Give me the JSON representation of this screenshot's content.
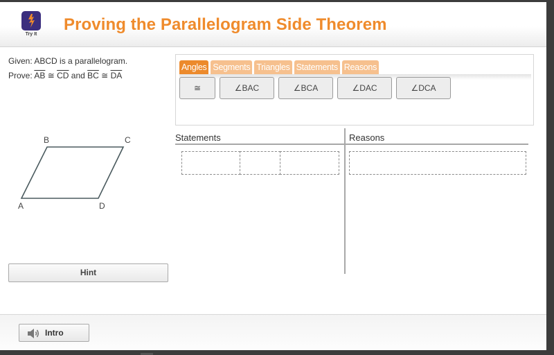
{
  "header": {
    "logo_icon": "lightning-bolt-icon",
    "logo_label": "Try It",
    "title": "Proving the Parallelogram Side Theorem"
  },
  "problem": {
    "given": "Given: ABCD is a parallelogram.",
    "prove_prefix": "Prove: ",
    "seg1": "AB",
    "cong": " ≅ ",
    "seg2": "CD",
    "and": " and ",
    "seg3": "BC",
    "seg4": "DA"
  },
  "figure": {
    "shape": "parallelogram",
    "vertex_labels": [
      "A",
      "B",
      "C",
      "D"
    ],
    "stroke_color": "#4a5a5e"
  },
  "hint_button": "Hint",
  "palette": {
    "tabs": [
      {
        "label": "Angles",
        "active": true
      },
      {
        "label": "Segments",
        "active": false
      },
      {
        "label": "Triangles",
        "active": false
      },
      {
        "label": "Statements",
        "active": false
      },
      {
        "label": "Reasons",
        "active": false
      }
    ],
    "tiles": [
      "≅",
      "∠BAC",
      "∠BCA",
      "∠DAC",
      "∠DCA"
    ]
  },
  "proof_table": {
    "statements_header": "Statements",
    "reasons_header": "Reasons",
    "rows": [
      {
        "statement_slots": [
          "",
          "",
          ""
        ],
        "reason": ""
      }
    ]
  },
  "footer": {
    "intro_icon": "speaker-icon",
    "intro_label": "Intro"
  },
  "colors": {
    "accent": "#ec8a2c",
    "tab_inactive": "#f6c08e",
    "logo_bg": "#3b2e7e",
    "title": "#ef8b2c"
  }
}
